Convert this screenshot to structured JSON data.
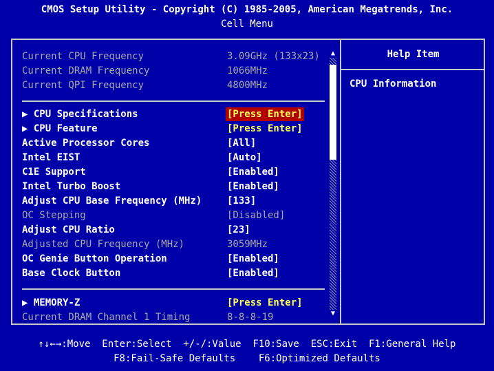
{
  "header": {
    "title": "CMOS Setup Utility - Copyright (C) 1985-2005, American Megatrends, Inc.",
    "menu": "Cell Menu"
  },
  "info": [
    {
      "label": "Current CPU Frequency",
      "value": "3.09GHz (133x23)"
    },
    {
      "label": "Current DRAM Frequency",
      "value": "1066MHz"
    },
    {
      "label": "Current QPI Frequency",
      "value": "4800MHz"
    }
  ],
  "items": [
    {
      "label": "▶ CPU Specifications",
      "value": "[Press Enter]"
    },
    {
      "label": "▶ CPU Feature",
      "value": "[Press Enter]"
    },
    {
      "label": "Active Processor Cores",
      "value": "[All]"
    },
    {
      "label": "Intel EIST",
      "value": "[Auto]"
    },
    {
      "label": "C1E Support",
      "value": "[Enabled]"
    },
    {
      "label": "Intel Turbo Boost",
      "value": "[Enabled]"
    },
    {
      "label": "Adjust CPU Base Frequency (MHz)",
      "value": "[133]"
    },
    {
      "label": "OC Stepping",
      "value": "[Disabled]"
    },
    {
      "label": "Adjust CPU Ratio",
      "value": "[23]"
    },
    {
      "label": "Adjusted CPU Frequency (MHz)",
      "value": "3059MHz"
    },
    {
      "label": "OC Genie Button Operation",
      "value": "[Enabled]"
    },
    {
      "label": "Base Clock Button",
      "value": "[Enabled]"
    }
  ],
  "memory": [
    {
      "label": "▶ MEMORY-Z",
      "value": "[Press Enter]"
    },
    {
      "label": "Current DRAM Channel 1 Timing",
      "value": "8-8-8-19"
    }
  ],
  "help": {
    "title": "Help Item",
    "text": "CPU Information"
  },
  "footer": {
    "line1": "↑↓←→:Move  Enter:Select  +/-/:Value  F10:Save  ESC:Exit  F1:General Help",
    "line2": "F8:Fail-Safe Defaults    F6:Optimized Defaults"
  },
  "colors": {
    "background": "#0000a8",
    "selected_bg": "#b30000",
    "highlight": "#ffff55",
    "dim": "#a8a8a8"
  }
}
